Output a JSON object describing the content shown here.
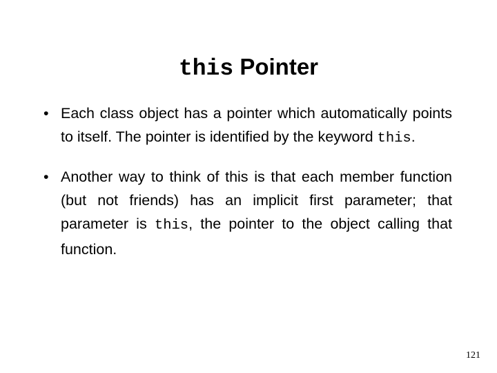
{
  "slide": {
    "title": {
      "code_part": "this",
      "text_part": " Pointer",
      "full": "this Pointer"
    },
    "bullets": [
      {
        "marker": "•",
        "segments": [
          {
            "type": "text",
            "value": "Each class object has a pointer which automatically points to itself. The pointer is identified by the keyword "
          },
          {
            "type": "code",
            "value": "this"
          },
          {
            "type": "text",
            "value": "."
          }
        ],
        "plain": "Each class object has a pointer which automatically points to itself. The pointer is identified by the keyword this."
      },
      {
        "marker": "•",
        "segments": [
          {
            "type": "text",
            "value": "Another way to think of this is that each member function (but not friends) has an implicit first parameter; that parameter is "
          },
          {
            "type": "code",
            "value": "this"
          },
          {
            "type": "text",
            "value": ", the pointer to the object calling that function."
          }
        ],
        "plain": "Another way to think of this is that each member function (but not friends) has an implicit first parameter; that parameter is this, the pointer to the object calling that function."
      }
    ],
    "page_number": "121",
    "colors": {
      "background": "#ffffff",
      "text": "#000000"
    }
  }
}
